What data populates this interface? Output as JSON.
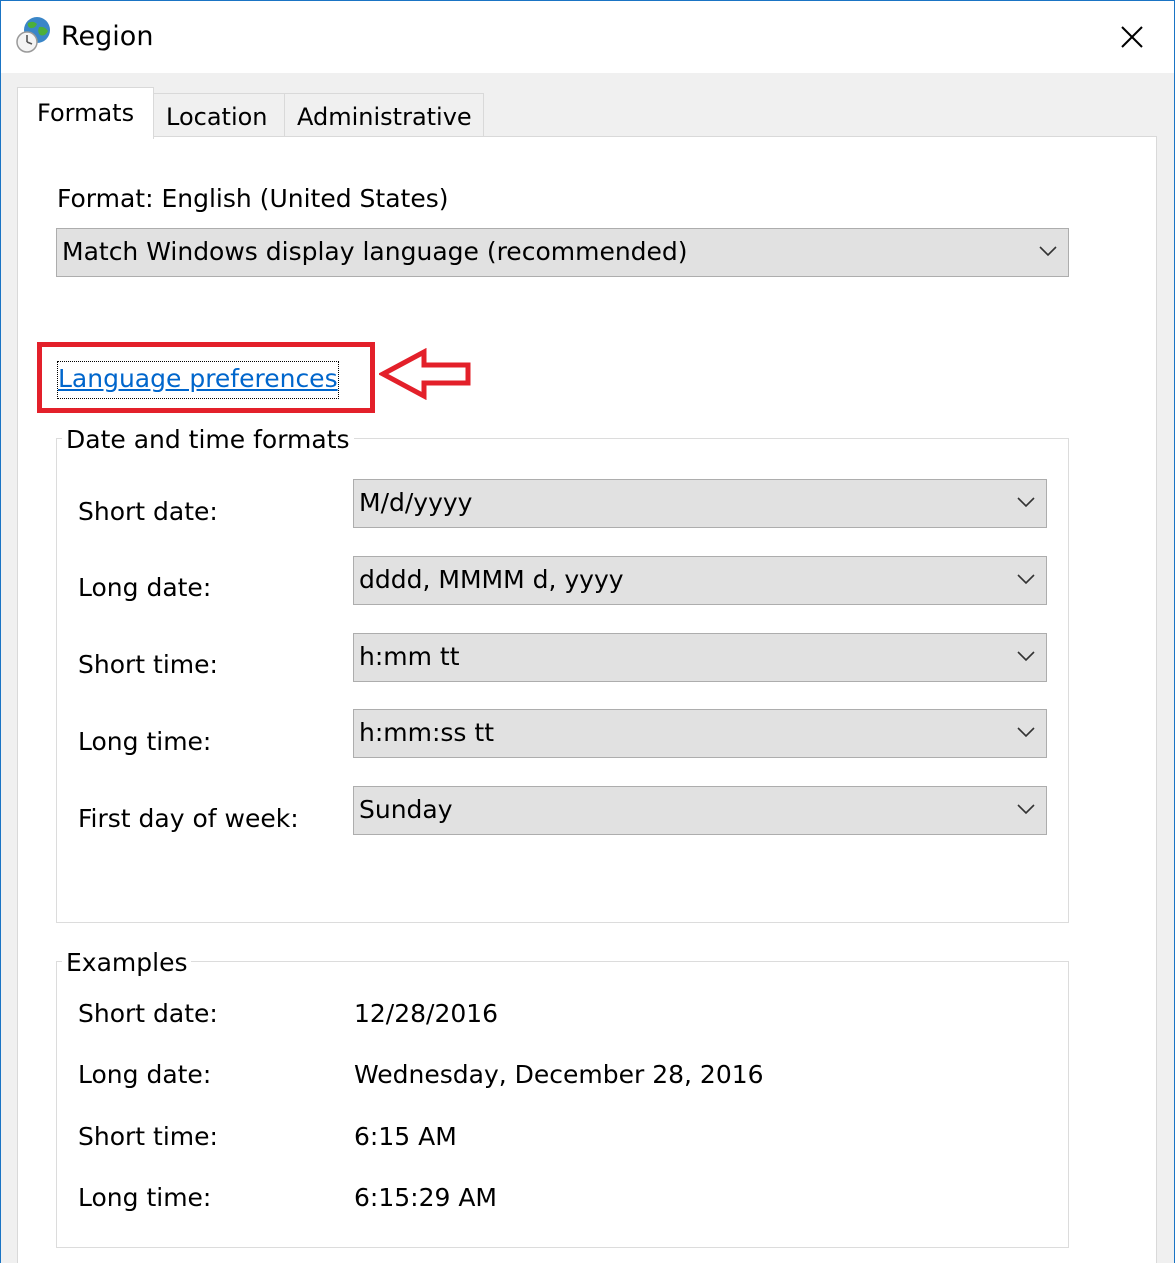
{
  "window": {
    "title": "Region",
    "icon": "globe-clock-icon",
    "close_icon": "close-icon"
  },
  "tabs": [
    {
      "label": "Formats",
      "active": true
    },
    {
      "label": "Location",
      "active": false
    },
    {
      "label": "Administrative",
      "active": false
    }
  ],
  "format": {
    "label": "Format: English (United States)",
    "selected": "Match Windows display language (recommended)"
  },
  "language_link": "Language preferences",
  "date_time_formats": {
    "title": "Date and time formats",
    "rows": [
      {
        "label": "Short date:",
        "value": "M/d/yyyy"
      },
      {
        "label": "Long date:",
        "value": "dddd, MMMM d, yyyy"
      },
      {
        "label": "Short time:",
        "value": "h:mm tt"
      },
      {
        "label": "Long time:",
        "value": "h:mm:ss tt"
      },
      {
        "label": "First day of week:",
        "value": "Sunday"
      }
    ]
  },
  "examples": {
    "title": "Examples",
    "rows": [
      {
        "label": "Short date:",
        "value": "12/28/2016"
      },
      {
        "label": "Long date:",
        "value": "Wednesday, December 28, 2016"
      },
      {
        "label": "Short time:",
        "value": "6:15 AM"
      },
      {
        "label": "Long time:",
        "value": "6:15:29 AM"
      }
    ]
  },
  "colors": {
    "annotation": "#e3202a",
    "link": "#0066cc",
    "combo_bg": "#e1e1e1"
  }
}
